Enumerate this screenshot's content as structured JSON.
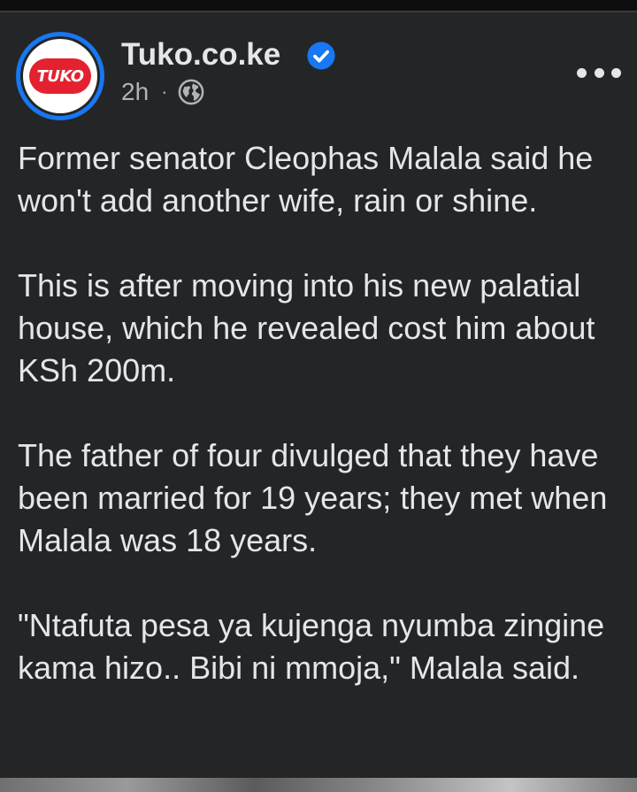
{
  "post": {
    "page_name": "Tuko.co.ke",
    "avatar_text": "TUKO",
    "time_ago": "2h",
    "separator": "·",
    "verified_icon": "verified-badge-icon",
    "privacy_icon": "globe-icon",
    "more_icon": "more-options-icon",
    "paragraphs": [
      "Former senator Cleophas Malala said he won't add another wife, rain or shine.",
      "This is after moving into his new palatial house, which he revealed cost him about KSh 200m.",
      "The father of four divulged that they have been married for 19 years; they met when Malala was 18 years.",
      "\"Ntafuta pesa ya kujenga nyumba zingine kama hizo.. Bibi ni mmoja,\" Malala said."
    ]
  },
  "colors": {
    "background": "#242526",
    "text_primary": "#e4e6eb",
    "text_secondary": "#b0b3b8",
    "accent_blue": "#1877f2",
    "brand_red": "#e4212f"
  }
}
